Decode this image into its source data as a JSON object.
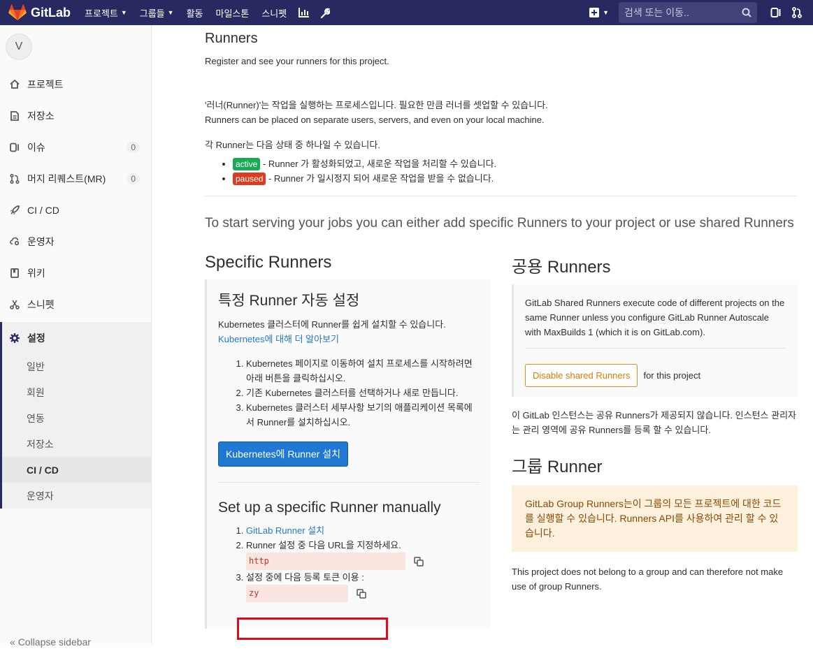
{
  "navbar": {
    "brand": "GitLab",
    "menu": [
      {
        "label": "프로젝트",
        "caret": true
      },
      {
        "label": "그룹들",
        "caret": true
      },
      {
        "label": "활동",
        "caret": false
      },
      {
        "label": "마일스톤",
        "caret": false
      },
      {
        "label": "스니펫",
        "caret": false
      }
    ],
    "search_placeholder": "검색 또는 이동..",
    "colors": {
      "navbar": "#292961",
      "logo": "#fc6d26"
    }
  },
  "sidebar": {
    "avatar_letter": "V",
    "items": [
      {
        "label": "프로젝트",
        "icon": "home-icon"
      },
      {
        "label": "저장소",
        "icon": "doc-icon"
      },
      {
        "label": "이슈",
        "icon": "issues-icon",
        "count": "0"
      },
      {
        "label": "머지 리퀘스트(MR)",
        "icon": "merge-request-icon",
        "count": "0"
      },
      {
        "label": "CI / CD",
        "icon": "rocket-icon"
      },
      {
        "label": "운영자",
        "icon": "cloud-gear-icon"
      },
      {
        "label": "위키",
        "icon": "book-icon"
      },
      {
        "label": "스니펫",
        "icon": "scissors-icon"
      }
    ],
    "settings_label": "설정",
    "settings_sub": [
      "일반",
      "회원",
      "연동",
      "저장소",
      "CI / CD",
      "운영자"
    ],
    "active_sub": "CI / CD",
    "collapse_label": "Collapse sidebar"
  },
  "runners": {
    "title": "Runners",
    "intro": "Register and see your runners for this project.",
    "desc1": "'러너(Runner)'는 작업을 실행하는 프로세스입니다. 필요한 만큼 러너를 셋업할 수 있습니다.",
    "desc2": "Runners can be placed on separate users, servers, and even on your local machine.",
    "states_intro": "각 Runner는 다음 상태 중 하나일 수 있습니다.",
    "states": [
      {
        "badge": "active",
        "text": " - Runner 가 활성화되었고, 새로운 작업을 처리할 수 있습니다.",
        "color": "#1aaa55"
      },
      {
        "badge": "paused",
        "text": " - Runner 가 일시정지 되어 새로운 작업을 받을 수 없습니다.",
        "color": "#db3b21"
      }
    ],
    "lead": "To start serving your jobs you can either add specific Runners to your project or use shared Runners"
  },
  "specific": {
    "heading": "Specific Runners",
    "auto_heading": "특정 Runner 자동 설정",
    "auto_desc": "Kubernetes 클러스터에 Runner를 쉽게 설치할 수 있습니다.",
    "learn_more": "Kubernetes에 대해 더 알아보기",
    "steps": [
      "Kubernetes 페이지로 이동하여 설치 프로세스를 시작하려면 아래 버튼을 클릭하십시오.",
      "기존 Kubernetes 클러스터를 선택하거나 새로 만듭니다.",
      "Kubernetes 클러스터 세부사항 보기의 애플리케이션 목록에서 Runner를 설치하십시오."
    ],
    "install_button": "Kubernetes에 Runner 설치",
    "manual_heading": "Set up a specific Runner manually",
    "manual_step1_link": "GitLab Runner 설치",
    "manual_step2": "Runner 설정 중 다음 URL을 지정하세요.",
    "url_value": "http",
    "manual_step3": "설정 중에 다음 등록 토큰 이용 :",
    "token_value": "zy"
  },
  "shared": {
    "heading": "공용 Runners",
    "desc": "GitLab Shared Runners execute code of different projects on the same Runner unless you configure GitLab Runner Autoscale with MaxBuilds 1 (which it is on GitLab.com).",
    "disable_button": "Disable shared Runners",
    "for_project": "for this project",
    "note": "이 GitLab 인스턴스는 공유 Runners가 제공되지 않습니다. 인스턴스 관리자는 관리 영역에 공유 Runners를 등록 할 수 있습니다."
  },
  "group": {
    "heading": "그룹 Runner",
    "warning": "GitLab Group Runners는이 그룹의 모든 프로젝트에 대한 코드를 실행할 수 있습니다. Runners API를 사용하여 관리 할 수 있습니다.",
    "note": "This project does not belong to a group and can therefore not make use of group Runners."
  }
}
